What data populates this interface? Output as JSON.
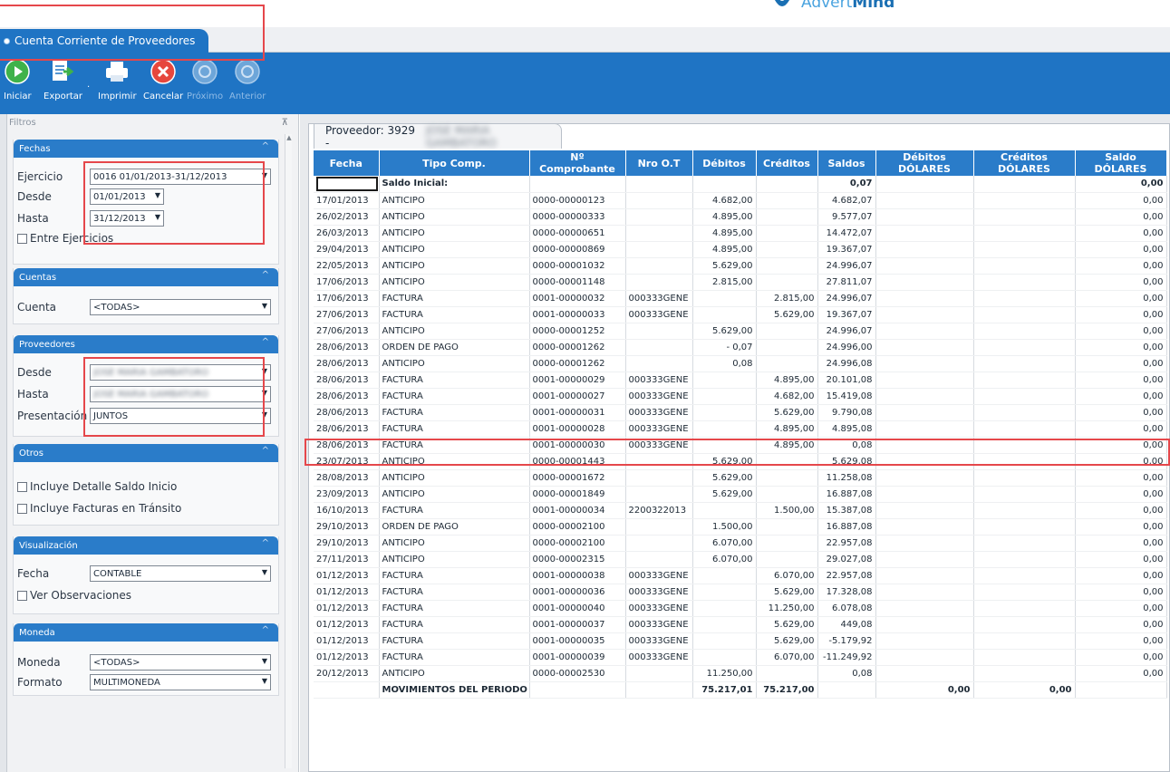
{
  "logo": {
    "text_light": "Advert",
    "text_bold": "Mind"
  },
  "tab": {
    "label": "Cuenta Corriente de Proveedores"
  },
  "toolbar": {
    "iniciar": "Iniciar",
    "exportar": "Exportar",
    "imprimir": "Imprimir",
    "cancelar": "Cancelar",
    "proximo": "Próximo",
    "anterior": "Anterior"
  },
  "filters": {
    "title": "Filtros",
    "pin": "⊼",
    "fechas": {
      "header": "Fechas",
      "ejercicio_label": "Ejercicio",
      "ejercicio_value": "0016 01/01/2013-31/12/2013",
      "desde_label": "Desde",
      "desde_value": "01/01/2013",
      "hasta_label": "Hasta",
      "hasta_value": "31/12/2013",
      "entre_label": "Entre Ejercicios"
    },
    "cuentas": {
      "header": "Cuentas",
      "cuenta_label": "Cuenta",
      "cuenta_value": "<TODAS>"
    },
    "proveedores": {
      "header": "Proveedores",
      "desde_label": "Desde",
      "desde_value": "JOSE MARIA GAMBATORO",
      "hasta_label": "Hasta",
      "hasta_value": "JOSE MARIA GAMBATORO",
      "presentacion_label": "Presentación",
      "presentacion_value": "JUNTOS"
    },
    "otros": {
      "header": "Otros",
      "detalle_label": "Incluye Detalle Saldo Inicio",
      "transito_label": "Incluye Facturas en Tránsito"
    },
    "visualizacion": {
      "header": "Visualización",
      "fecha_label": "Fecha",
      "fecha_value": "CONTABLE",
      "obs_label": "Ver Observaciones"
    },
    "moneda": {
      "header": "Moneda",
      "moneda_label": "Moneda",
      "moneda_value": "<TODAS>",
      "formato_label": "Formato",
      "formato_value": "MULTIMONEDA"
    }
  },
  "proveedor": {
    "label": "Proveedor: 3929 -",
    "name": "JOSE MARIA GAMBATORO"
  },
  "grid": {
    "headers": [
      "Fecha",
      "Tipo Comp.",
      "Nº Comprobante",
      "Nro O.T",
      "Débitos",
      "Créditos",
      "Saldos",
      "Débitos DÓLARES",
      "Créditos DÓLARES",
      "Saldo DÓLARES"
    ],
    "initial": {
      "label": "Saldo Inicial:",
      "saldo": "0,07",
      "saldo_usd": "0,00"
    },
    "rows": [
      [
        "17/01/2013",
        "ANTICIPO",
        "0000-00000123",
        "",
        "4.682,00",
        "",
        "4.682,07",
        "",
        "",
        "0,00"
      ],
      [
        "26/02/2013",
        "ANTICIPO",
        "0000-00000333",
        "",
        "4.895,00",
        "",
        "9.577,07",
        "",
        "",
        "0,00"
      ],
      [
        "26/03/2013",
        "ANTICIPO",
        "0000-00000651",
        "",
        "4.895,00",
        "",
        "14.472,07",
        "",
        "",
        "0,00"
      ],
      [
        "29/04/2013",
        "ANTICIPO",
        "0000-00000869",
        "",
        "4.895,00",
        "",
        "19.367,07",
        "",
        "",
        "0,00"
      ],
      [
        "22/05/2013",
        "ANTICIPO",
        "0000-00001032",
        "",
        "5.629,00",
        "",
        "24.996,07",
        "",
        "",
        "0,00"
      ],
      [
        "17/06/2013",
        "ANTICIPO",
        "0000-00001148",
        "",
        "2.815,00",
        "",
        "27.811,07",
        "",
        "",
        "0,00"
      ],
      [
        "17/06/2013",
        "FACTURA",
        "0001-00000032",
        "000333GENE",
        "",
        "2.815,00",
        "24.996,07",
        "",
        "",
        "0,00"
      ],
      [
        "27/06/2013",
        "FACTURA",
        "0001-00000033",
        "000333GENE",
        "",
        "5.629,00",
        "19.367,07",
        "",
        "",
        "0,00"
      ],
      [
        "27/06/2013",
        "ANTICIPO",
        "0000-00001252",
        "",
        "5.629,00",
        "",
        "24.996,07",
        "",
        "",
        "0,00"
      ],
      [
        "28/06/2013",
        "ORDEN DE PAGO",
        "0000-00001262",
        "",
        "- 0,07",
        "",
        "24.996,00",
        "",
        "",
        "0,00"
      ],
      [
        "28/06/2013",
        "ANTICIPO",
        "0000-00001262",
        "",
        "0,08",
        "",
        "24.996,08",
        "",
        "",
        "0,00"
      ],
      [
        "28/06/2013",
        "FACTURA",
        "0001-00000029",
        "000333GENE",
        "",
        "4.895,00",
        "20.101,08",
        "",
        "",
        "0,00"
      ],
      [
        "28/06/2013",
        "FACTURA",
        "0001-00000027",
        "000333GENE",
        "",
        "4.682,00",
        "15.419,08",
        "",
        "",
        "0,00"
      ],
      [
        "28/06/2013",
        "FACTURA",
        "0001-00000031",
        "000333GENE",
        "",
        "5.629,00",
        "9.790,08",
        "",
        "",
        "0,00"
      ],
      [
        "28/06/2013",
        "FACTURA",
        "0001-00000028",
        "000333GENE",
        "",
        "4.895,00",
        "4.895,08",
        "",
        "",
        "0,00"
      ],
      [
        "28/06/2013",
        "FACTURA",
        "0001-00000030",
        "000333GENE",
        "",
        "4.895,00",
        "0,08",
        "",
        "",
        "0,00"
      ],
      [
        "23/07/2013",
        "ANTICIPO",
        "0000-00001443",
        "",
        "5.629,00",
        "",
        "5.629,08",
        "",
        "",
        "0,00"
      ],
      [
        "28/08/2013",
        "ANTICIPO",
        "0000-00001672",
        "",
        "5.629,00",
        "",
        "11.258,08",
        "",
        "",
        "0,00"
      ],
      [
        "23/09/2013",
        "ANTICIPO",
        "0000-00001849",
        "",
        "5.629,00",
        "",
        "16.887,08",
        "",
        "",
        "0,00"
      ],
      [
        "16/10/2013",
        "FACTURA",
        "0001-00000034",
        "2200322013",
        "",
        "1.500,00",
        "15.387,08",
        "",
        "",
        "0,00"
      ],
      [
        "29/10/2013",
        "ORDEN DE PAGO",
        "0000-00002100",
        "",
        "1.500,00",
        "",
        "16.887,08",
        "",
        "",
        "0,00"
      ],
      [
        "29/10/2013",
        "ANTICIPO",
        "0000-00002100",
        "",
        "6.070,00",
        "",
        "22.957,08",
        "",
        "",
        "0,00"
      ],
      [
        "27/11/2013",
        "ANTICIPO",
        "0000-00002315",
        "",
        "6.070,00",
        "",
        "29.027,08",
        "",
        "",
        "0,00"
      ],
      [
        "01/12/2013",
        "FACTURA",
        "0001-00000038",
        "000333GENE",
        "",
        "6.070,00",
        "22.957,08",
        "",
        "",
        "0,00"
      ],
      [
        "01/12/2013",
        "FACTURA",
        "0001-00000036",
        "000333GENE",
        "",
        "5.629,00",
        "17.328,08",
        "",
        "",
        "0,00"
      ],
      [
        "01/12/2013",
        "FACTURA",
        "0001-00000040",
        "000333GENE",
        "",
        "11.250,00",
        "6.078,08",
        "",
        "",
        "0,00"
      ],
      [
        "01/12/2013",
        "FACTURA",
        "0001-00000037",
        "000333GENE",
        "",
        "5.629,00",
        "449,08",
        "",
        "",
        "0,00"
      ],
      [
        "01/12/2013",
        "FACTURA",
        "0001-00000035",
        "000333GENE",
        "",
        "5.629,00",
        "-5.179,92",
        "",
        "",
        "0,00"
      ],
      [
        "01/12/2013",
        "FACTURA",
        "0001-00000039",
        "000333GENE",
        "",
        "6.070,00",
        "-11.249,92",
        "",
        "",
        "0,00"
      ],
      [
        "20/12/2013",
        "ANTICIPO",
        "0000-00002530",
        "",
        "11.250,00",
        "",
        "0,08",
        "",
        "",
        "0,00"
      ]
    ],
    "total": {
      "label": "MOVIMIENTOS DEL PERIODO",
      "debitos": "75.217,01",
      "creditos": "75.217,00",
      "deb_usd": "0,00",
      "cred_usd": "0,00"
    }
  },
  "colors": {
    "accent": "#1f74c4",
    "header": "#2a7cc9",
    "annotation": "#e5474b"
  }
}
